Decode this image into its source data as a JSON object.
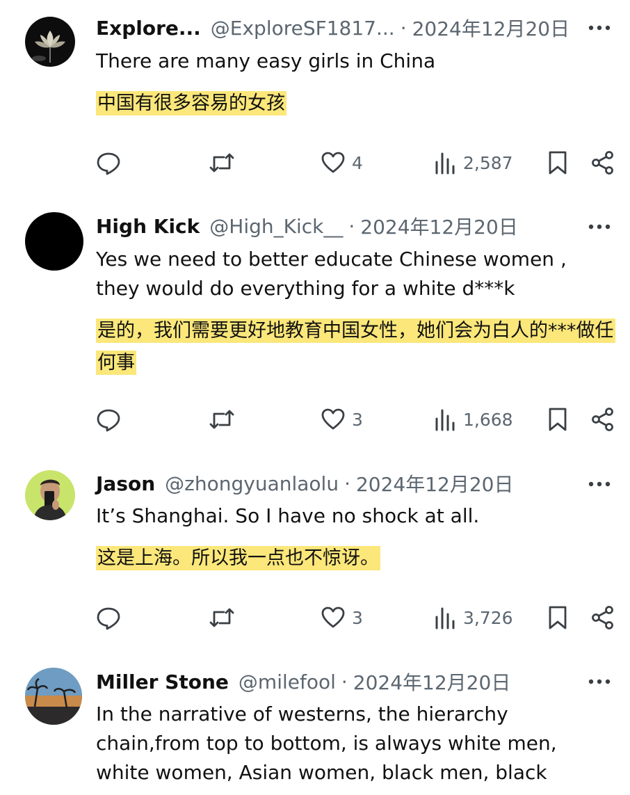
{
  "posts": [
    {
      "name": "Explore...",
      "handle": "@ExploreSF1817...",
      "separator": "·",
      "date": "2024年12月20日",
      "text": [
        "There are many easy girls in China"
      ],
      "translation": "中国有很多容易的女孩",
      "likes": "4",
      "views": "2,587",
      "avatar_icon": "lotus-avatar"
    },
    {
      "name": "High Kick",
      "handle": "@High_Kick__",
      "separator": "·",
      "date": "2024年12月20日",
      "text": [
        "Yes we need to better educate Chinese women ,",
        "they would do everything for a white d***k"
      ],
      "translation": "是的，我们需要更好地教育中国女性，她们会为白人的***做任何事",
      "likes": "3",
      "views": "1,668",
      "avatar_icon": "black-circle-avatar"
    },
    {
      "name": "Jason",
      "handle": "@zhongyuanlaolu",
      "separator": "·",
      "date": "2024年12月20日",
      "text": [
        "It’s Shanghai. So I have no shock at all."
      ],
      "translation": "这是上海。所以我一点也不惊讶。",
      "likes": "3",
      "views": "3,726",
      "avatar_icon": "selfie-avatar"
    },
    {
      "name": "Miller Stone",
      "handle": "@milefool",
      "separator": "·",
      "date": "2024年12月20日",
      "text": [
        "In the narrative of westerns, the hierarchy",
        "chain,from top to bottom, is always white men,",
        "white women, Asian women, black men, black"
      ],
      "avatar_icon": "sunset-palm-avatar"
    }
  ],
  "colors": {
    "highlight": "#fbe77a",
    "secondary_text": "#5b6670",
    "icon": "#3a3f44"
  }
}
